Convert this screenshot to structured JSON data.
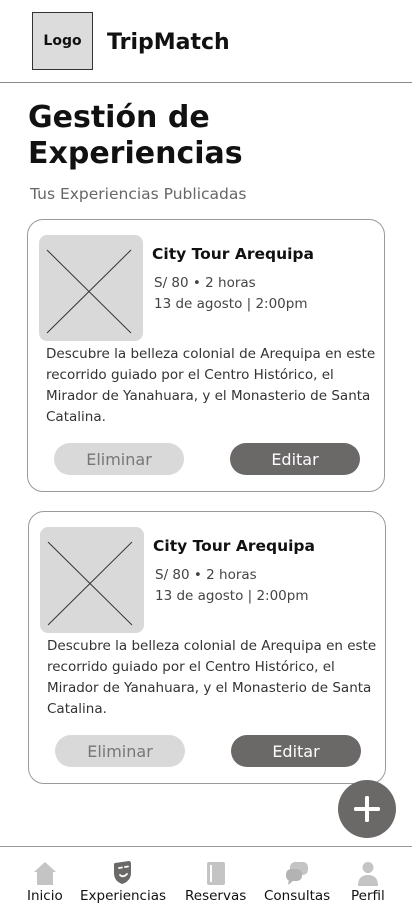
{
  "header": {
    "logo_text": "Logo",
    "app_name": "TripMatch"
  },
  "page": {
    "title": "Gestión de Experiencias",
    "subtitle": "Tus Experiencias Publicadas"
  },
  "experiences": [
    {
      "title": "City Tour Arequipa",
      "price_duration": "S/ 80 • 2 horas",
      "date_time": "13 de agosto | 2:00pm",
      "description": "Descubre la belleza colonial de Arequipa en este recorrido guiado por el Centro Histórico, el Mirador de Yanahuara, y el Monasterio de Santa Catalina.",
      "delete_label": "Eliminar",
      "edit_label": "Editar"
    },
    {
      "title": "City Tour Arequipa",
      "price_duration": "S/ 80 • 2 horas",
      "date_time": "13 de agosto | 2:00pm",
      "description": "Descubre la belleza colonial de Arequipa en este recorrido guiado por el Centro Histórico, el Mirador de Yanahuara, y el Monasterio de Santa Catalina.",
      "delete_label": "Eliminar",
      "edit_label": "Editar"
    }
  ],
  "fab": {
    "icon": "plus-icon"
  },
  "bottom_nav": [
    {
      "label": "Inicio",
      "icon": "home-icon"
    },
    {
      "label": "Experiencias",
      "icon": "masks-icon"
    },
    {
      "label": "Reservas",
      "icon": "book-icon"
    },
    {
      "label": "Consultas",
      "icon": "chat-icon"
    },
    {
      "label": "Perfil",
      "icon": "user-icon"
    }
  ],
  "colors": {
    "primary_button": "#6b6868",
    "secondary_button": "#d9d9d9",
    "nav_icon": "#c4c4c4",
    "nav_icon_active": "#6b6868"
  }
}
